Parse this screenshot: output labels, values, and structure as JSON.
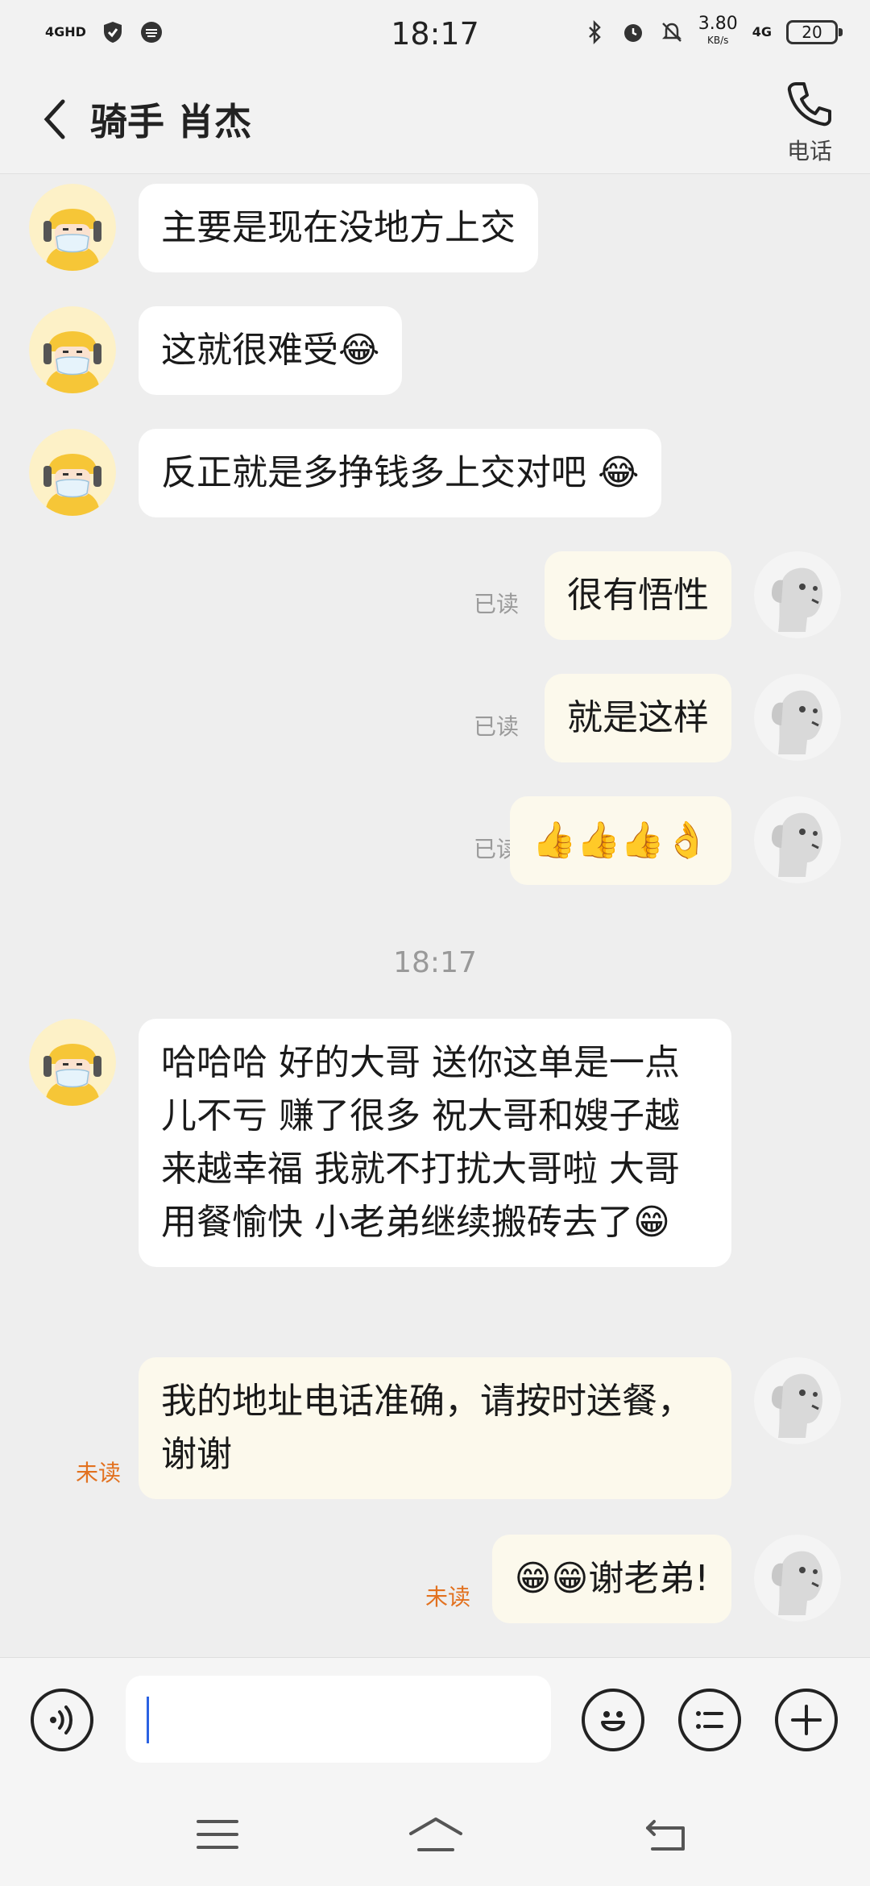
{
  "status_bar": {
    "network": "4GHD",
    "time": "18:17",
    "speed_value": "3.80",
    "speed_unit": "KB/s",
    "network_type": "4G",
    "battery": "20"
  },
  "header": {
    "title": "骑手 肖杰",
    "call_label": "电话"
  },
  "messages": [
    {
      "side": "in",
      "text": "主要是现在没地方上交"
    },
    {
      "side": "in",
      "text": "这就很难受😂"
    },
    {
      "side": "in",
      "text": "反正就是多挣钱多上交对吧 😂"
    },
    {
      "side": "out",
      "text": "很有悟性",
      "receipt": "已读"
    },
    {
      "side": "out",
      "text": "就是这样",
      "receipt": "已读"
    },
    {
      "side": "out",
      "text": "👍👍👍👌",
      "receipt": "已读"
    },
    {
      "side": "in",
      "text": "哈哈哈 好的大哥 送你这单是一点儿不亏 赚了很多 祝大哥和嫂子越来越幸福  我就不打扰大哥啦 大哥用餐愉快 小老弟继续搬砖去了😁"
    },
    {
      "side": "out",
      "text": "我的地址电话准确，请按时送餐，谢谢",
      "receipt": "未读"
    },
    {
      "side": "out",
      "text": "😁😁谢老弟!",
      "receipt": "未读"
    }
  ],
  "timestamp": "18:17",
  "input": {
    "placeholder": ""
  },
  "colors": {
    "background": "#eeeeee",
    "incoming_bubble": "#ffffff",
    "outgoing_bubble": "#fcf9ec",
    "read_receipt": "#9a9a9a",
    "unread_receipt": "#e2711f",
    "caret": "#2b62e3"
  },
  "icons": {
    "back": "chevron-left-icon",
    "call": "phone-icon",
    "voice": "voice-icon",
    "emoji": "emoji-icon",
    "quick_reply": "list-icon",
    "more": "plus-icon",
    "nav_menu": "menu-icon",
    "nav_home": "home-icon",
    "nav_back": "back-icon"
  }
}
